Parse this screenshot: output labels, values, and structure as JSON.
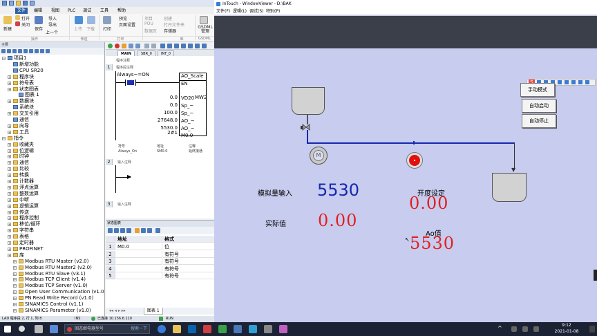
{
  "left_window": {
    "menu_tabs": [
      "文件",
      "编辑",
      "视图",
      "PLC",
      "调试",
      "工具",
      "帮助"
    ],
    "ribbon": {
      "new": "新建",
      "open": "打开",
      "close": "关闭",
      "save": "保存",
      "import": "导入",
      "export": "导出",
      "previous": "上一个",
      "upload": "上传",
      "download": "下载",
      "print": "打印",
      "preview": "预览",
      "page_setup": "页面设置",
      "project_label": "项目",
      "vary": "可变",
      "pou": "POU",
      "data_page": "数据页",
      "create": "创建",
      "open_folder": "打开文件夹",
      "memory_card": "存储器",
      "gsdml": "GSDML管理",
      "groups": [
        "操作",
        "传送",
        "打印",
        "",
        "库",
        "GSDML"
      ]
    },
    "tree_header": "主要",
    "tree_items": [
      {
        "label": "项目1",
        "level": 0,
        "icon": "project"
      },
      {
        "label": "新增功能",
        "level": 1,
        "icon": "info"
      },
      {
        "label": "CPU SR20",
        "level": 1,
        "icon": "cpu"
      },
      {
        "label": "程序块",
        "level": 1,
        "icon": "folder"
      },
      {
        "label": "符号表",
        "level": 1,
        "icon": "folder"
      },
      {
        "label": "状态图表",
        "level": 1,
        "icon": "folder"
      },
      {
        "label": "图表 1",
        "level": 2,
        "icon": "table"
      },
      {
        "label": "数据块",
        "level": 1,
        "icon": "folder"
      },
      {
        "label": "系统块",
        "level": 1,
        "icon": "block"
      },
      {
        "label": "交叉引用",
        "level": 1,
        "icon": "folder"
      },
      {
        "label": "通信",
        "level": 1,
        "icon": "block"
      },
      {
        "label": "向导",
        "level": 1,
        "icon": "folder"
      },
      {
        "label": "工具",
        "level": 1,
        "icon": "folder"
      },
      {
        "label": "指令",
        "level": 0,
        "icon": "folder"
      },
      {
        "label": "收藏夹",
        "level": 1,
        "icon": "folder"
      },
      {
        "label": "位逻辑",
        "level": 1,
        "icon": "folder"
      },
      {
        "label": "时钟",
        "level": 1,
        "icon": "folder"
      },
      {
        "label": "通信",
        "level": 1,
        "icon": "folder"
      },
      {
        "label": "比较",
        "level": 1,
        "icon": "folder"
      },
      {
        "label": "转换",
        "level": 1,
        "icon": "folder"
      },
      {
        "label": "计数器",
        "level": 1,
        "icon": "folder"
      },
      {
        "label": "浮点运算",
        "level": 1,
        "icon": "folder"
      },
      {
        "label": "整数运算",
        "level": 1,
        "icon": "folder"
      },
      {
        "label": "中断",
        "level": 1,
        "icon": "folder"
      },
      {
        "label": "逻辑运算",
        "level": 1,
        "icon": "folder"
      },
      {
        "label": "传送",
        "level": 1,
        "icon": "folder"
      },
      {
        "label": "程序控制",
        "level": 1,
        "icon": "folder"
      },
      {
        "label": "移位/循环",
        "level": 1,
        "icon": "folder"
      },
      {
        "label": "字符串",
        "level": 1,
        "icon": "folder"
      },
      {
        "label": "表格",
        "level": 1,
        "icon": "folder"
      },
      {
        "label": "定时器",
        "level": 1,
        "icon": "folder"
      },
      {
        "label": "PROFINET",
        "level": 1,
        "icon": "folder"
      },
      {
        "label": "库",
        "level": 1,
        "icon": "folder"
      },
      {
        "label": "Modbus RTU Master (v2.0)",
        "level": 2,
        "icon": "folder"
      },
      {
        "label": "Modbus RTU Master2 (v2.0)",
        "level": 2,
        "icon": "folder"
      },
      {
        "label": "Modbus RTU Slave (v3.1)",
        "level": 2,
        "icon": "folder"
      },
      {
        "label": "Modbus TCP Client (v1.4)",
        "level": 2,
        "icon": "folder"
      },
      {
        "label": "Modbus TCP Server (v1.0)",
        "level": 2,
        "icon": "folder"
      },
      {
        "label": "Open User Communication (v1.0)",
        "level": 2,
        "icon": "folder"
      },
      {
        "label": "PN Read Write Record (v1.0)",
        "level": 2,
        "icon": "folder"
      },
      {
        "label": "SINAMICS Control (v1.1)",
        "level": 2,
        "icon": "folder"
      },
      {
        "label": "SINAMICS Parameter (v1.0)",
        "level": 2,
        "icon": "folder"
      }
    ],
    "lad_tabs": [
      "MAIN",
      "SBR_0",
      "INT_0"
    ],
    "lad": {
      "program_comment": "程序注释",
      "network1_num": "1",
      "network1_comment": "程序段注释",
      "contact_label": "Always~=ON",
      "block_title": "AO_Scale",
      "en": "EN",
      "inputs": [
        {
          "value": "0.0",
          "pin": "VD20"
        },
        {
          "value": "0.0",
          "pin": "Sp_~"
        },
        {
          "value": "100.0",
          "pin": "Sp_~"
        },
        {
          "value": "27648.0",
          "pin": "AO_~"
        },
        {
          "value": "5530.0",
          "pin": "AO_~"
        },
        {
          "value": "2#1",
          "pin": "M0.0"
        }
      ],
      "output_pin": "MW2",
      "symbol_headers": [
        "符号",
        "地址",
        "注释"
      ],
      "symbol_row": [
        "Always_On",
        "SM0.0",
        "始终接通"
      ],
      "network2_num": "2",
      "network2_comment": "输入注释",
      "network3_num": "3",
      "network3_comment": "输入注释"
    },
    "status_chart": {
      "header": "状态图表",
      "columns": [
        "地址",
        "格式"
      ],
      "rows": [
        {
          "num": "1",
          "address": "M0.0",
          "format": "位"
        },
        {
          "num": "2",
          "address": "",
          "format": "有符号"
        },
        {
          "num": "3",
          "address": "",
          "format": "有符号"
        },
        {
          "num": "4",
          "address": "",
          "format": "有符号"
        },
        {
          "num": "5",
          "address": "",
          "format": "有符号"
        }
      ],
      "sheet_tab": "图表 1"
    },
    "statusbar": {
      "left": "LAD 程序段 2, 行 1, 列 8",
      "ins": "INS",
      "connected": "已连接 10.156.6.110",
      "run": "RUN"
    }
  },
  "intouch": {
    "title": "InTouch - WindowViewer - D:\\BAK",
    "menu": [
      "文件(F)",
      "逻辑(L)",
      "调试(S)",
      "特别(P)"
    ],
    "labels": {
      "analog_input": "模拟量输入",
      "actual_value": "实际值",
      "opening_set": "开度设定",
      "ao_value": "Ao值",
      "motor": "M"
    },
    "values": {
      "analog_input": "5530",
      "actual_value": "0.00",
      "opening_set": "0.00",
      "ao_value": "5530"
    },
    "buttons": [
      "手动模式",
      "自动启动",
      "自动停止"
    ]
  },
  "taskbar": {
    "search_text": "固态继电器型号",
    "search_suffix": "搜索一下",
    "time": "9:12",
    "date": "2021-01-08"
  }
}
